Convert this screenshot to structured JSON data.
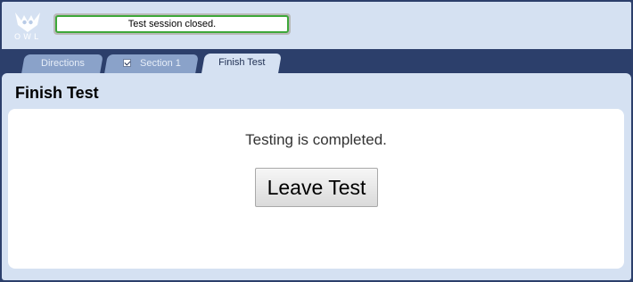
{
  "header": {
    "logo_icon": "owl-logo-icon",
    "logo_text": "OWL",
    "status_message": "Test session closed.",
    "status_color": "#3da83a"
  },
  "tabs": [
    {
      "label": "Directions",
      "active": false,
      "checked": false
    },
    {
      "label": "Section 1",
      "active": false,
      "checked": true
    },
    {
      "label": "Finish Test",
      "active": true,
      "checked": false
    }
  ],
  "panel": {
    "title": "Finish Test",
    "message": "Testing is completed.",
    "leave_button_label": "Leave Test"
  },
  "colors": {
    "frame": "#2c3f6b",
    "panel_bg": "#d5e1f2",
    "tab_inactive": "#8aa2c9"
  }
}
